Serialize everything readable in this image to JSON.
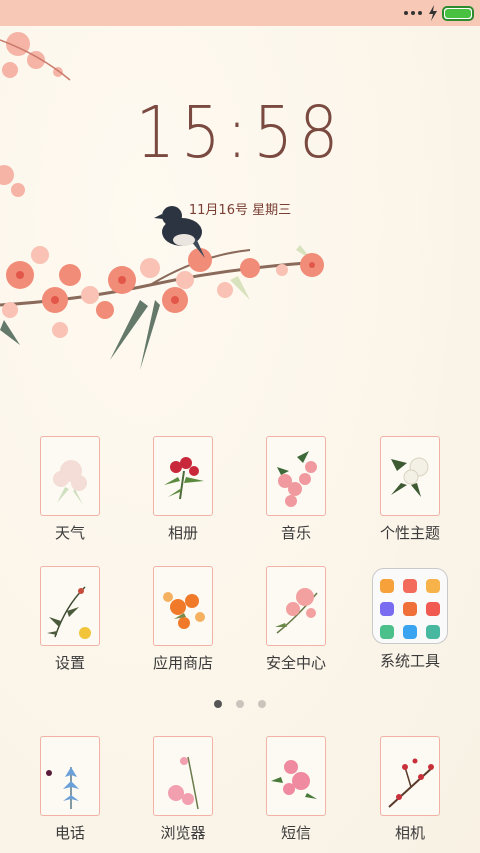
{
  "status_bar": {
    "battery_level": 1.0,
    "accent": "#48c040"
  },
  "lockscreen": {
    "time": "15:58",
    "date": "11月16号 星期三"
  },
  "apps": [
    {
      "label": "天气",
      "icon": "flower-weather-icon"
    },
    {
      "label": "相册",
      "icon": "flower-gallery-icon"
    },
    {
      "label": "音乐",
      "icon": "flower-music-icon"
    },
    {
      "label": "个性主题",
      "icon": "flower-themes-icon"
    },
    {
      "label": "设置",
      "icon": "flower-settings-icon"
    },
    {
      "label": "应用商店",
      "icon": "flower-appstore-icon"
    },
    {
      "label": "安全中心",
      "icon": "flower-security-icon"
    },
    {
      "label": "系统工具",
      "icon": "system-tools-folder-icon"
    }
  ],
  "page_indicator": {
    "pages": 3,
    "current": 1
  },
  "dock": [
    {
      "label": "电话",
      "icon": "flower-phone-icon"
    },
    {
      "label": "浏览器",
      "icon": "flower-browser-icon"
    },
    {
      "label": "短信",
      "icon": "flower-messages-icon"
    },
    {
      "label": "相机",
      "icon": "flower-camera-icon"
    }
  ],
  "colors": {
    "background": "#fbf6ec",
    "status_bar": "#f7c8b6",
    "tile_border": "#f2b2a6",
    "clock": "#7a4a40"
  }
}
